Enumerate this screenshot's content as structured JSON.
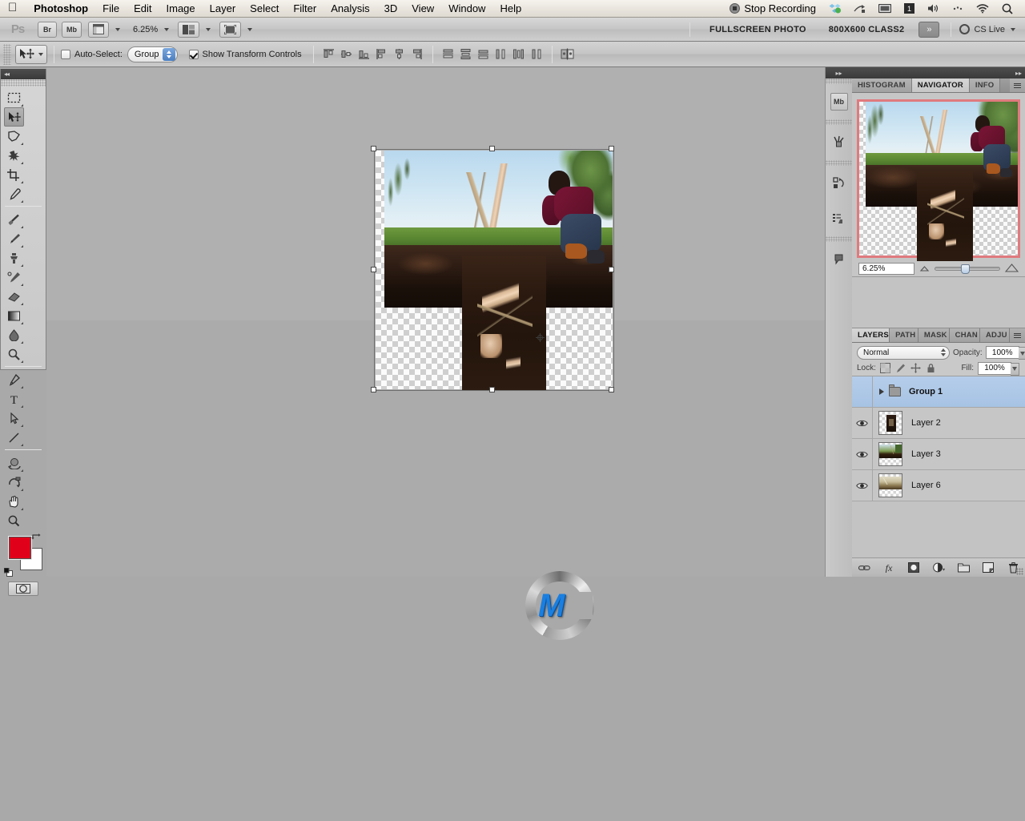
{
  "menubar": {
    "apple_icon": "apple-icon",
    "items": [
      "Photoshop",
      "File",
      "Edit",
      "Image",
      "Layer",
      "Select",
      "Filter",
      "Analysis",
      "3D",
      "View",
      "Window",
      "Help"
    ],
    "app_name": "Photoshop",
    "right": {
      "stop_recording": "Stop Recording",
      "icons": [
        "dropbox-icon",
        "share-icon",
        "display-icon",
        "screen-number-icon",
        "volume-icon",
        "bluetooth-icon",
        "wifi-icon",
        "spotlight-search-icon"
      ]
    }
  },
  "appbar": {
    "logo": "Ps",
    "bridge_label": "Br",
    "minibridge_label": "Mb",
    "view_extras_icon": "view-extras-icon",
    "zoom_level": "6.25%",
    "screen_mode_icon": "arrange-documents-icon",
    "screen_mode2_icon": "screen-mode-icon",
    "workspace_primary": "FULLSCREEN PHOTO",
    "workspace_secondary": "800X600 CLASS2",
    "overflow_label": "»",
    "cs_live": "CS Live"
  },
  "options": {
    "tool_icon": "move-tool-icon",
    "auto_select_label": "Auto-Select:",
    "auto_select_checked": false,
    "auto_select_value": "Group",
    "show_transform_label": "Show Transform Controls",
    "show_transform_checked": true,
    "align_icons": [
      "align-top-edges-icon",
      "align-vertical-centers-icon",
      "align-bottom-edges-icon",
      "align-left-edges-icon",
      "align-horizontal-centers-icon",
      "align-right-edges-icon"
    ],
    "distribute_icons": [
      "distribute-top-edges-icon",
      "distribute-vertical-centers-icon",
      "distribute-bottom-edges-icon",
      "distribute-left-edges-icon",
      "distribute-horizontal-centers-icon",
      "distribute-right-edges-icon"
    ],
    "auto_align_icon": "auto-align-layers-icon"
  },
  "toolbox": {
    "tools": [
      {
        "name": "rectangular-marquee-tool",
        "selected": false
      },
      {
        "name": "move-tool",
        "selected": true
      },
      {
        "name": "lasso-tool",
        "selected": false
      },
      {
        "name": "quick-selection-tool",
        "selected": false
      },
      {
        "name": "crop-tool",
        "selected": false
      },
      {
        "name": "eyedropper-tool",
        "selected": false
      },
      {
        "name": "spot-healing-brush-tool",
        "selected": false
      },
      {
        "name": "brush-tool",
        "selected": false
      },
      {
        "name": "clone-stamp-tool",
        "selected": false
      },
      {
        "name": "history-brush-tool",
        "selected": false
      },
      {
        "name": "eraser-tool",
        "selected": false
      },
      {
        "name": "gradient-tool",
        "selected": false
      },
      {
        "name": "blur-tool",
        "selected": false
      },
      {
        "name": "dodge-tool",
        "selected": false
      },
      {
        "name": "pen-tool",
        "selected": false
      },
      {
        "name": "horizontal-type-tool",
        "selected": false
      },
      {
        "name": "path-selection-tool",
        "selected": false
      },
      {
        "name": "line-shape-tool",
        "selected": false
      },
      {
        "name": "3d-object-rotate-tool",
        "selected": false
      },
      {
        "name": "3d-camera-rotate-tool",
        "selected": false
      },
      {
        "name": "hand-tool",
        "selected": false
      },
      {
        "name": "zoom-tool",
        "selected": false
      }
    ],
    "foreground_color": "#e00019",
    "background_color": "#ffffff",
    "swap_icon": "swap-colors-icon",
    "default_icon": "default-colors-icon",
    "quickmask_icon": "quick-mask-mode-icon"
  },
  "dockstrip": {
    "icons": [
      "mini-bridge-icon",
      "tool-presets-icon",
      "history-icon",
      "actions-icon",
      "notes-icon"
    ]
  },
  "navigator": {
    "tabs": [
      {
        "label": "HISTOGRAM",
        "active": false
      },
      {
        "label": "NAVIGATOR",
        "active": true
      },
      {
        "label": "INFO",
        "active": false
      }
    ],
    "menu_icon": "panel-menu-icon",
    "view_box_color": "#e07a7e",
    "zoom_value": "6.25%",
    "zoom_out_icon": "zoom-out-icon",
    "zoom_in_icon": "zoom-in-icon"
  },
  "layers": {
    "tabs": [
      {
        "label": "LAYERS",
        "active": true
      },
      {
        "label": "PATH",
        "active": false
      },
      {
        "label": "MASK",
        "active": false
      },
      {
        "label": "CHAN",
        "active": false
      },
      {
        "label": "ADJU",
        "active": false
      }
    ],
    "menu_icon": "panel-menu-icon",
    "blend_mode": "Normal",
    "opacity_label": "Opacity:",
    "opacity_value": "100%",
    "lock_label": "Lock:",
    "lock_icons": [
      "lock-transparent-pixels-icon",
      "lock-image-pixels-icon",
      "lock-position-icon",
      "lock-all-icon"
    ],
    "fill_label": "Fill:",
    "fill_value": "100%",
    "rows": [
      {
        "name": "Group 1",
        "type": "group",
        "selected": true,
        "visible": false,
        "expanded": false
      },
      {
        "name": "Layer 2",
        "type": "layer",
        "selected": false,
        "visible": true
      },
      {
        "name": "Layer 3",
        "type": "layer",
        "selected": false,
        "visible": true
      },
      {
        "name": "Layer 6",
        "type": "layer",
        "selected": false,
        "visible": true
      }
    ],
    "bottom_icons": [
      "link-layers-icon",
      "add-layer-style-icon",
      "add-layer-mask-icon",
      "new-adjustment-layer-icon",
      "new-group-icon",
      "new-layer-icon",
      "delete-layer-icon"
    ]
  },
  "canvas": {
    "document_zoom": "6.25%",
    "transform_handles": 8,
    "center_marker_icon": "transform-center-point-icon",
    "watermark_letter": "M"
  }
}
